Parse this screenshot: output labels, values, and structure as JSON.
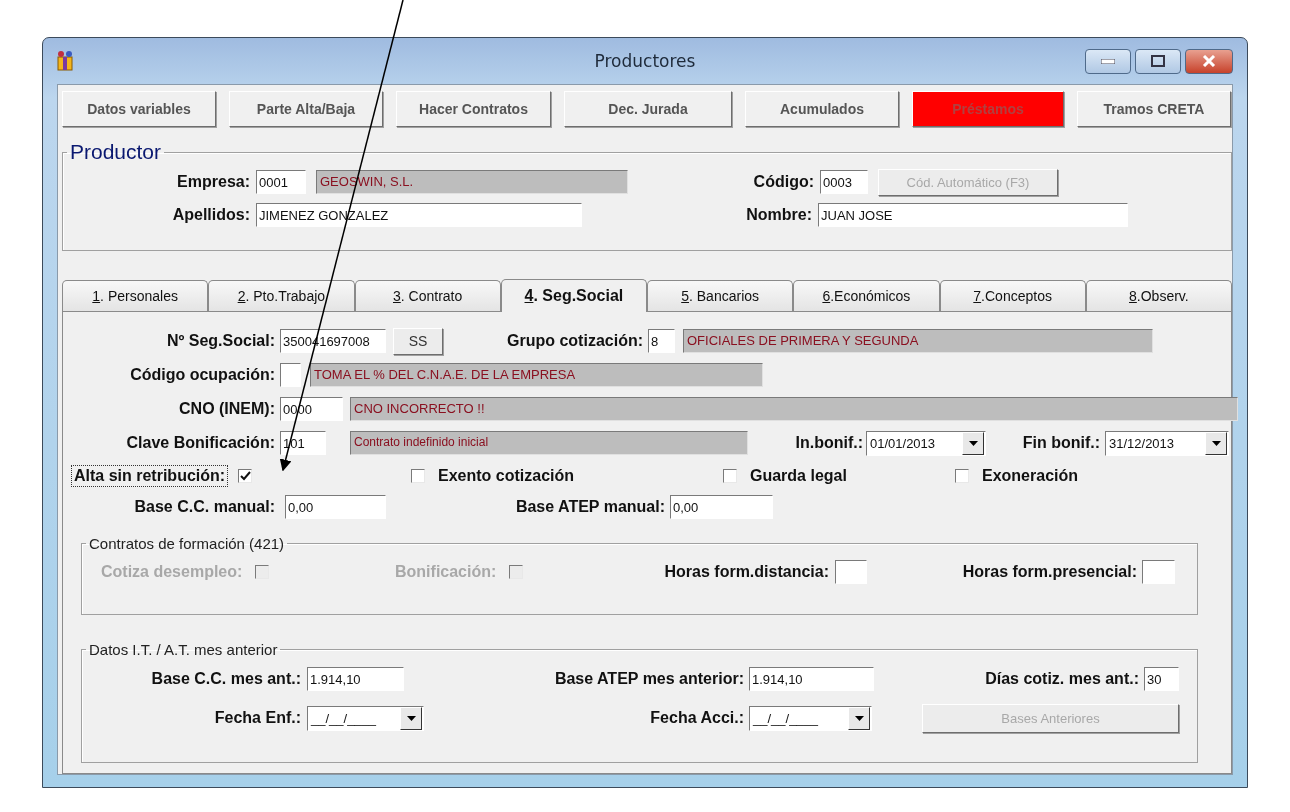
{
  "window": {
    "title": "Productores"
  },
  "toolbar": [
    {
      "label": "Datos variables",
      "alert": false
    },
    {
      "label": "Parte Alta/Baja",
      "alert": false
    },
    {
      "label": "Hacer Contratos",
      "alert": false
    },
    {
      "label": "Dec. Jurada",
      "alert": false
    },
    {
      "label": "Acumulados",
      "alert": false
    },
    {
      "label": "Préstamos",
      "alert": true
    },
    {
      "label": "Tramos CRETA",
      "alert": false
    }
  ],
  "productor": {
    "title": "Productor",
    "empresa": {
      "label": "Empresa:",
      "code": "0001",
      "name": "GEOSWIN, S.L."
    },
    "codigo": {
      "label": "Código:",
      "value": "0003",
      "button": "Cód. Automático (F3)",
      "button_disabled": true
    },
    "apellidos": {
      "label": "Apellidos:",
      "value": "JIMENEZ GONZALEZ"
    },
    "nombre": {
      "label": "Nombre:",
      "value": "JUAN JOSE"
    }
  },
  "tabs": [
    {
      "label": "1. Personales",
      "selected": false
    },
    {
      "label": "2. Pto.Trabajo",
      "selected": false
    },
    {
      "label": "3. Contrato",
      "selected": false
    },
    {
      "label": "4. Seg.Social",
      "selected": true
    },
    {
      "label": "5. Bancarios",
      "selected": false
    },
    {
      "label": "6.Económicos",
      "selected": false
    },
    {
      "label": "7.Conceptos",
      "selected": false
    },
    {
      "label": "8.Observ.",
      "selected": false
    }
  ],
  "seg_social": {
    "nss": {
      "label": "Nº Seg.Social:",
      "value": "350041697008",
      "button": "SS"
    },
    "grupo": {
      "label": "Grupo cotización:",
      "value": "8",
      "description": "OFICIALES DE PRIMERA Y SEGUNDA"
    },
    "ocupacion": {
      "label": "Código ocupación:",
      "description": "TOMA EL % DEL C.N.A.E. DE LA EMPRESA"
    },
    "cno": {
      "label": "CNO (INEM):",
      "value": "0000",
      "description": "CNO INCORRECTO !!"
    },
    "bonificacion": {
      "label": "Clave Bonificación:",
      "value": "101",
      "description": "Contrato indefinido inicial"
    },
    "inicio": {
      "label": "In.bonif.:",
      "value": "01/01/2013"
    },
    "fin": {
      "label": "Fin bonif.:",
      "value": "31/12/2013"
    },
    "checks": [
      {
        "kind": "label-first",
        "label": "Alta sin retribución:",
        "checked": true,
        "focused": true
      },
      {
        "kind": "box-first",
        "label": "Exento cotización",
        "checked": false,
        "focused": false
      },
      {
        "kind": "box-first",
        "label": "Guarda legal",
        "checked": false,
        "focused": false
      },
      {
        "kind": "box-first",
        "label": "Exoneración",
        "checked": false,
        "focused": false
      }
    ],
    "base_cc": {
      "label": "Base C.C. manual:",
      "value": "0,00"
    },
    "base_atep": {
      "label": "Base ATEP manual:",
      "value": "0,00"
    }
  },
  "formacion": {
    "title": "Contratos de formación (421)",
    "checks": [
      {
        "label": "Cotiza desempleo:",
        "checked": false,
        "disabled": true
      },
      {
        "label": "Bonificación:",
        "checked": false,
        "disabled": true
      }
    ],
    "horas_distancia": {
      "label": "Horas form.distancia:"
    },
    "horas_presencial": {
      "label": "Horas form.presencial:"
    }
  },
  "it_at": {
    "title": "Datos I.T. / A.T. mes anterior",
    "base_cc": {
      "label": "Base C.C. mes ant.:",
      "value": "1.914,10"
    },
    "base_atep": {
      "label": "Base ATEP mes anterior:",
      "value": "1.914,10"
    },
    "dias": {
      "label": "Días cotiz. mes ant.:",
      "value": "30"
    },
    "fecha_enf": {
      "label": "Fecha Enf.:",
      "value": "__/__/____"
    },
    "fecha_acci": {
      "label": "Fecha Acci.:",
      "value": "__/__/____"
    },
    "button": {
      "label": "Bases Anteriores",
      "disabled": true
    }
  }
}
